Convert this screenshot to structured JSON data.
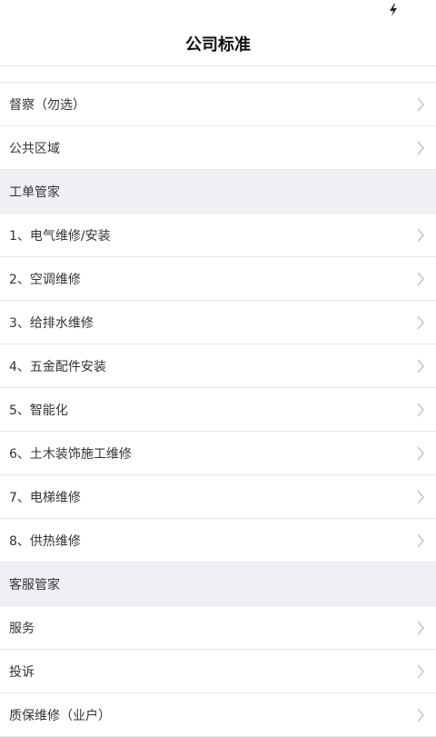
{
  "status_bar": {
    "charging_icon": "lightning-bolt-icon"
  },
  "header": {
    "title": "公司标准"
  },
  "list": {
    "top_items": [
      {
        "label": "督察（勿选）"
      },
      {
        "label": "公共区域"
      }
    ],
    "section_work_order": {
      "label": "工单管家"
    },
    "work_order_items": [
      {
        "label": "1、电气维修/安装"
      },
      {
        "label": "2、空调维修"
      },
      {
        "label": "3、给排水维修"
      },
      {
        "label": "4、五金配件安装"
      },
      {
        "label": "5、智能化"
      },
      {
        "label": "6、土木装饰施工维修"
      },
      {
        "label": "7、电梯维修"
      },
      {
        "label": "8、供热维修"
      }
    ],
    "section_customer_service": {
      "label": "客服管家"
    },
    "customer_service_items": [
      {
        "label": "服务"
      },
      {
        "label": "投诉"
      },
      {
        "label": "质保维修（业户）"
      }
    ],
    "chevron_icon": "chevron-right-icon"
  }
}
